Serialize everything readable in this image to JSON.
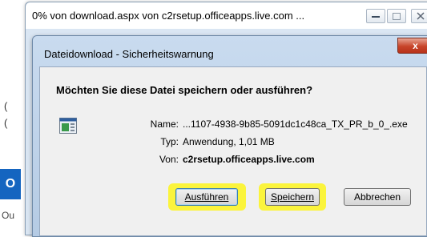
{
  "background": {
    "frag1": "(",
    "frag2": "(",
    "outlook_letter": "O",
    "outlook_label": "Ou"
  },
  "progress_window": {
    "title": "0% von download.aspx von c2rsetup.officeapps.live.com ...",
    "minimize_icon": "minimize-icon",
    "maximize_icon": "maximize-icon",
    "close_icon": "close-icon"
  },
  "dialog": {
    "title": "Dateidownload - Sicherheitswarnung",
    "question": "Möchten Sie diese Datei speichern oder ausführen?",
    "fields": {
      "name_label": "Name:",
      "name_value": "...1107-4938-9b85-5091dc1c48ca_TX_PR_b_0_.exe",
      "type_label": "Typ:",
      "type_value": "Anwendung, 1,01 MB",
      "from_label": "Von:",
      "from_value": "c2rsetup.officeapps.live.com"
    },
    "buttons": {
      "run": "Ausführen",
      "save": "Speichern",
      "cancel": "Abbrechen"
    },
    "close_glyph": "x"
  },
  "colors": {
    "highlight": "#fff500",
    "close_red": "#c7442a",
    "outlook_blue": "#1565c0"
  }
}
